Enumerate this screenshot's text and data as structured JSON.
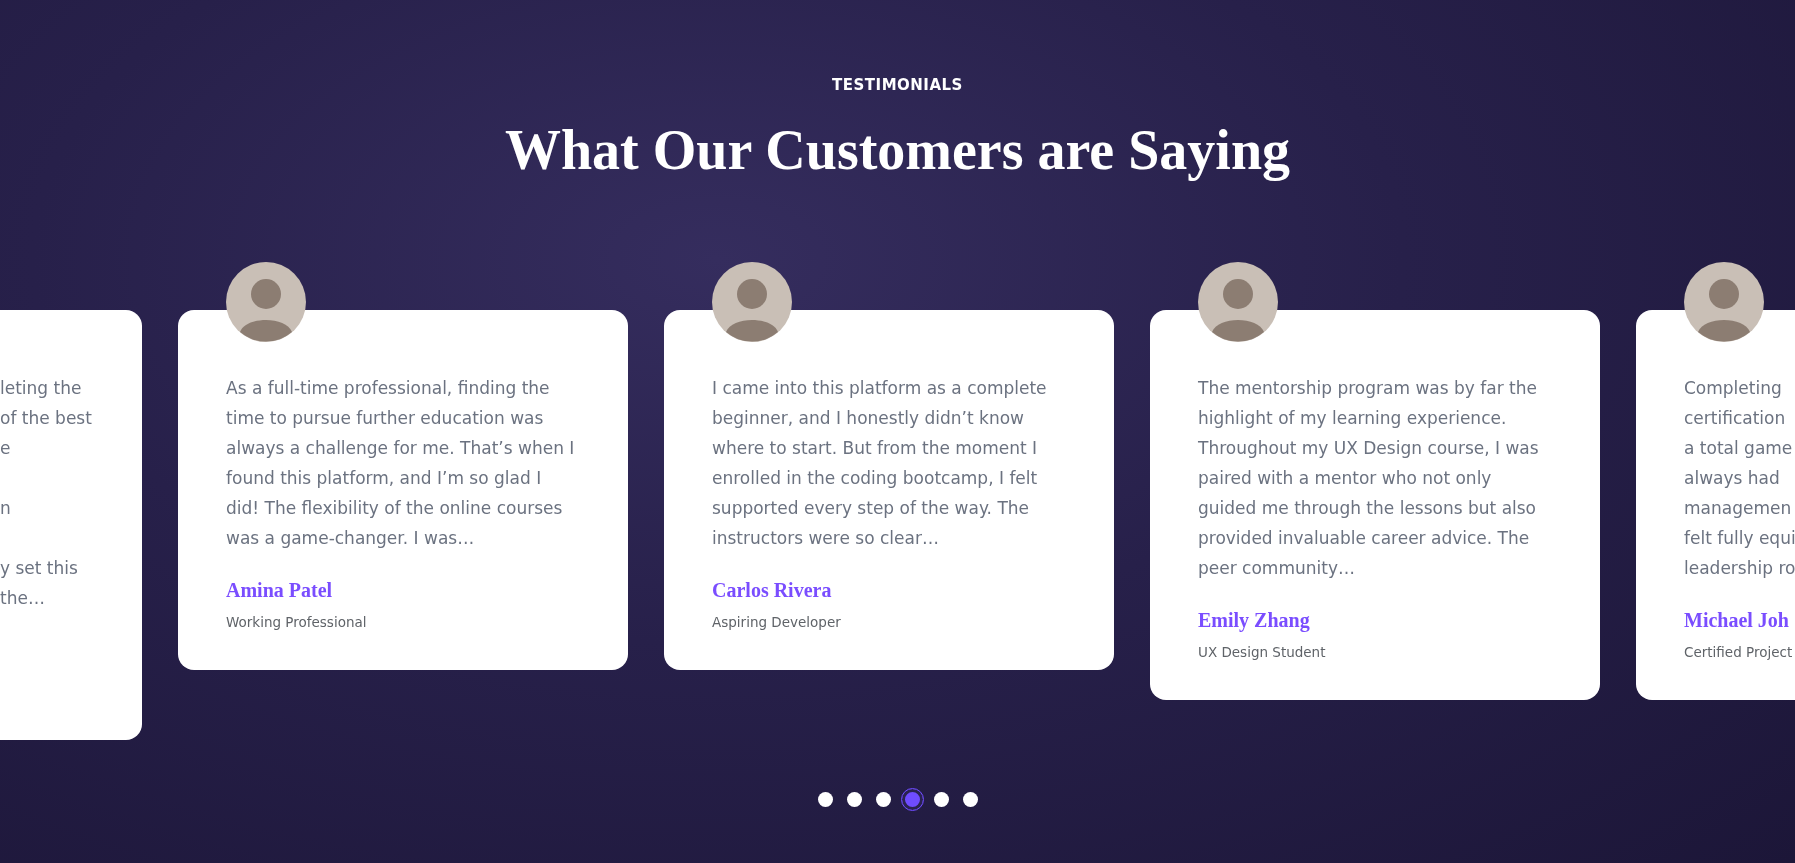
{
  "section": {
    "eyebrow": "TESTIMONIALS",
    "title": "What Our Customers are Saying"
  },
  "testimonials": [
    {
      "kind": "clipped-left",
      "quote": "leting the\nof the best\ne\n\nn\n\ny set this\nthe…"
    },
    {
      "kind": "full",
      "quote": "As a full-time professional, finding the time to pursue further education was always a challenge for me. That’s when I found this platform, and I’m so glad I did! The flexibility of the online courses was a game-changer. I was…",
      "name": "Amina Patel",
      "role": "Working Professional"
    },
    {
      "kind": "full",
      "quote": "I came into this platform as a complete beginner, and I honestly didn’t know where to start. But from the moment I enrolled in the coding bootcamp, I felt supported every step of the way. The instructors were so clear…",
      "name": "Carlos Rivera",
      "role": "Aspiring Developer"
    },
    {
      "kind": "full",
      "quote": "The mentorship program was by far the highlight of my learning experience. Throughout my UX Design course, I was paired with a mentor who not only guided me through the lessons but also provided invaluable career advice. The peer community…",
      "name": "Emily Zhang",
      "role": "UX Design Student"
    },
    {
      "kind": "clipped-right",
      "quote": "Completing\ncertification\na total game\nalways had\nmanagemen\nfelt fully equi\nleadership ro",
      "name": "Michael Joh",
      "role": "Certified Project"
    }
  ],
  "pagination": [
    {
      "selected": false
    },
    {
      "selected": false
    },
    {
      "selected": false
    },
    {
      "selected": true
    },
    {
      "selected": false
    },
    {
      "selected": false
    }
  ]
}
